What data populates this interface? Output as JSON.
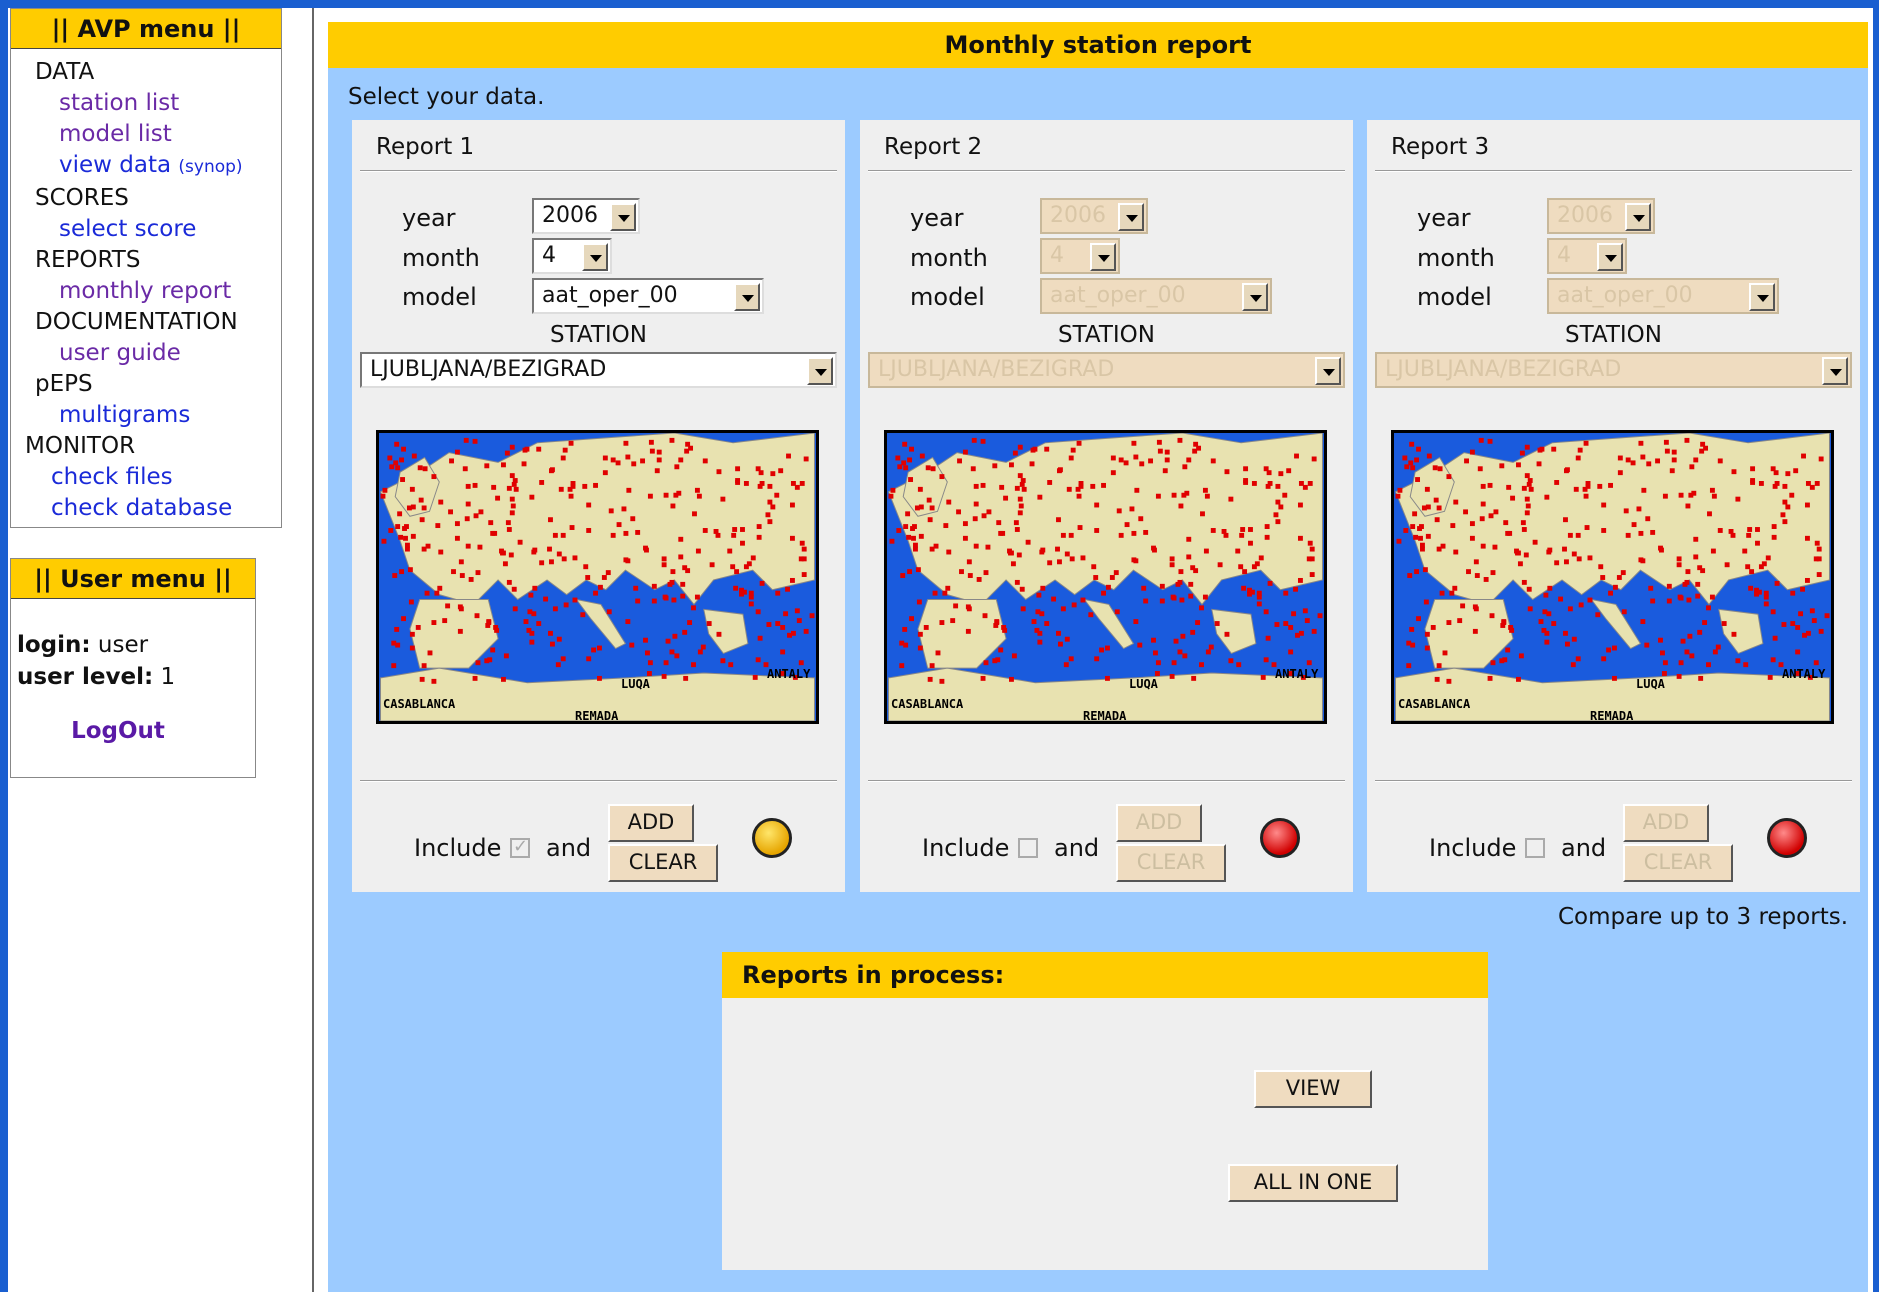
{
  "avp_menu": {
    "title": "|| AVP menu ||",
    "data_label": "DATA",
    "station_list": "station list",
    "model_list": "model list",
    "view_data": "view data",
    "view_data_note": "(synop)",
    "scores_label": "SCORES",
    "select_score": "select score",
    "reports_label": "REPORTS",
    "monthly_report": "monthly report",
    "documentation_label": "DOCUMENTATION",
    "user_guide": "user guide",
    "peps_label": "pEPS",
    "multigrams": "multigrams",
    "monitor_label": "MONITOR",
    "check_files": "check files",
    "check_database": "check database"
  },
  "user_menu": {
    "title": "|| User menu ||",
    "login_label": "login:",
    "login_value": "user",
    "level_label": "user level:",
    "level_value": "1",
    "logout": "LogOut"
  },
  "main": {
    "title": "Monthly station report",
    "intro": "Select your data.",
    "compare_note": "Compare up to 3 reports."
  },
  "form_labels": {
    "year": "year",
    "month": "month",
    "model": "model",
    "station": "STATION",
    "include": "Include",
    "and": "and",
    "add": "ADD",
    "clear": "CLEAR"
  },
  "reports": [
    {
      "title": "Report 1",
      "year": "2006",
      "month": "4",
      "model": "aat_oper_00",
      "station": "LJUBLJANA/BEZIGRAD",
      "enabled": true,
      "include_checked": true,
      "status_color": "yellow"
    },
    {
      "title": "Report 2",
      "year": "2006",
      "month": "4",
      "model": "aat_oper_00",
      "station": "LJUBLJANA/BEZIGRAD",
      "enabled": false,
      "include_checked": false,
      "status_color": "red"
    },
    {
      "title": "Report 3",
      "year": "2006",
      "month": "4",
      "model": "aat_oper_00",
      "station": "LJUBLJANA/BEZIGRAD",
      "enabled": false,
      "include_checked": false,
      "status_color": "red"
    }
  ],
  "map_labels": {
    "casablanca": "CASABLANCA",
    "luqa": "LUQA",
    "antalya": "ANTALY",
    "remada": "REMADA"
  },
  "process": {
    "title": "Reports in process:",
    "view": "VIEW",
    "all_in_one": "ALL IN ONE"
  },
  "colors": {
    "accent": "#ffcc00",
    "panel_bg": "#9ccbff",
    "sea": "#1a5bdd",
    "land": "#e8e2b0",
    "station_dot": "#e00000"
  }
}
